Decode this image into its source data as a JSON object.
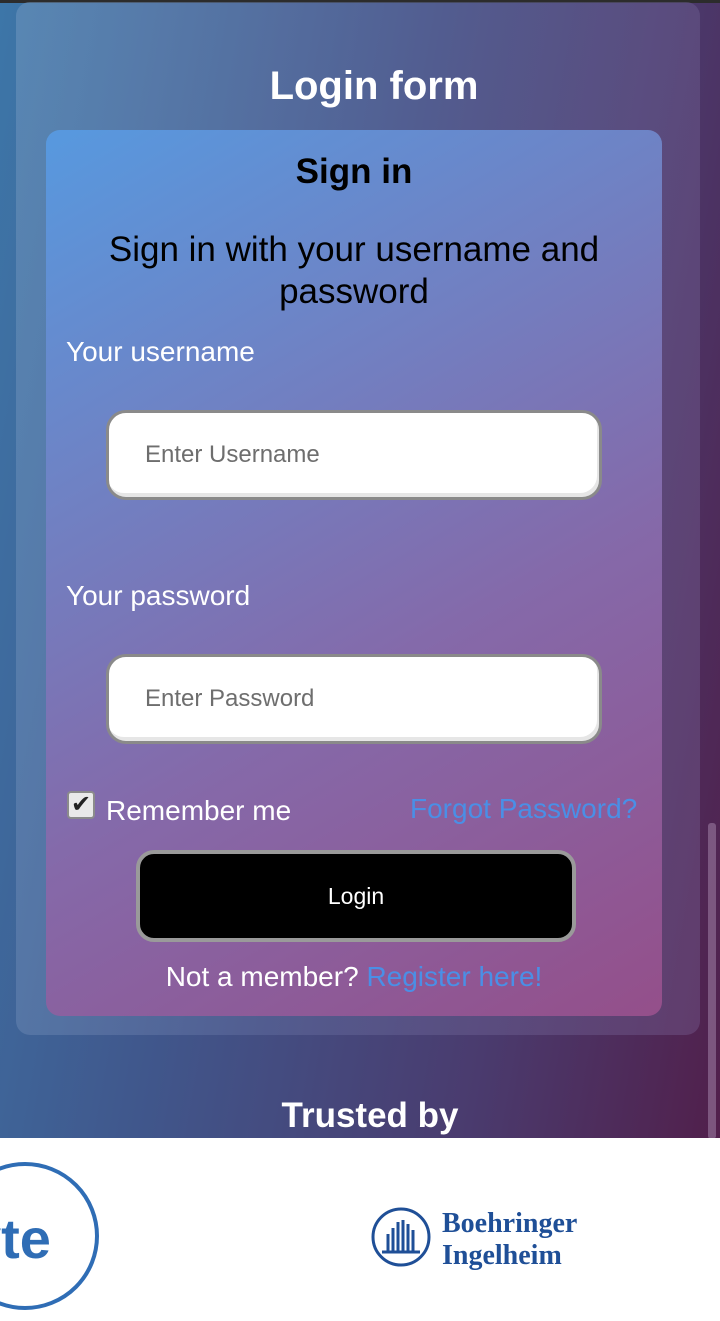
{
  "form": {
    "section_title": "Login form",
    "card_title": "Sign in",
    "card_subtitle": "Sign in with your username and password",
    "username_label": "Your username",
    "username_placeholder": "Enter Username",
    "password_label": "Your password",
    "password_placeholder": "Enter Password",
    "remember_label": "Remember me",
    "remember_checked": true,
    "forgot_link": "Forgot Password?",
    "login_button": "Login",
    "not_member": "Not a member?",
    "register_link": "Register here!"
  },
  "trusted": {
    "title": "Trusted by",
    "logos": [
      {
        "name": "yte-logo",
        "text": "yte"
      },
      {
        "name": "boehringer-ingelheim-logo",
        "line1": "Boehringer",
        "line2": "Ingelheim"
      }
    ]
  },
  "colors": {
    "link": "#4a8fe6",
    "button_bg": "#000000",
    "logo_blue": "#1f4f97"
  }
}
